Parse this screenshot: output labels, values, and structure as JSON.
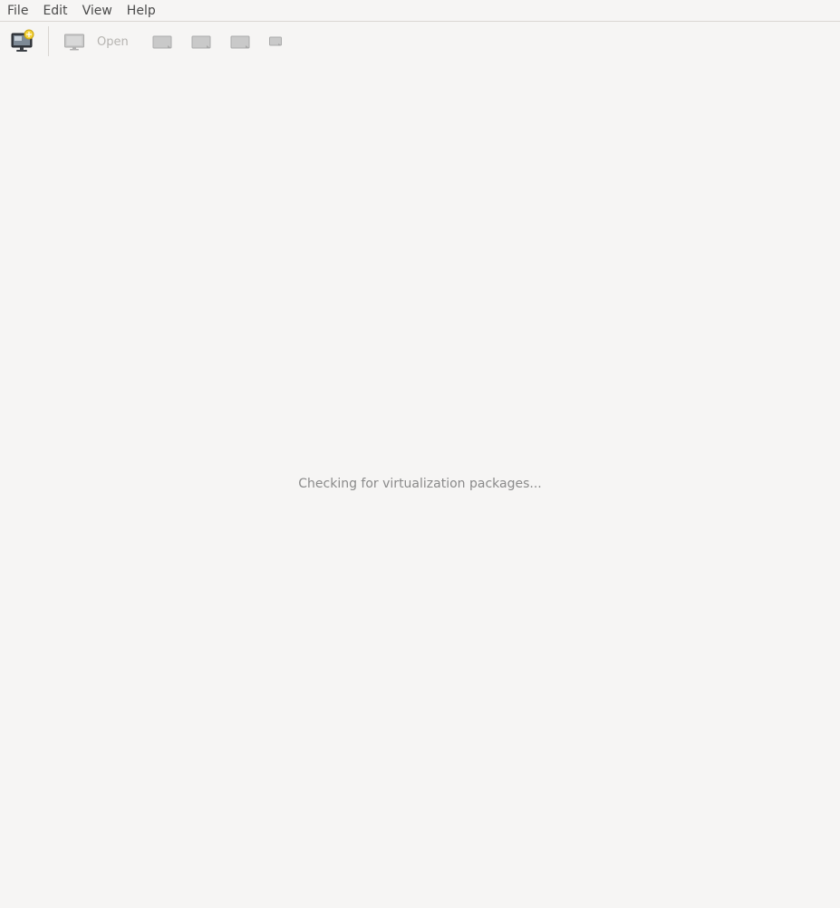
{
  "menubar": {
    "items": [
      {
        "label": "File"
      },
      {
        "label": "Edit"
      },
      {
        "label": "View"
      },
      {
        "label": "Help"
      }
    ]
  },
  "toolbar": {
    "new_vm": {
      "icon": "new-vm-icon"
    },
    "open": {
      "label": "Open",
      "icon": "monitor-icon"
    },
    "run": {
      "icon": "run-icon"
    },
    "pause": {
      "icon": "pause-icon"
    },
    "shutdown": {
      "icon": "shutdown-icon"
    },
    "shutdown_menu": {
      "icon": "dropdown-icon"
    }
  },
  "main": {
    "status_text": "Checking for virtualization packages..."
  },
  "colors": {
    "background": "#f6f5f4",
    "disabled_text": "#b6b4b1",
    "status_text": "#8a8a8a",
    "menu_text": "#4a4a4a"
  }
}
